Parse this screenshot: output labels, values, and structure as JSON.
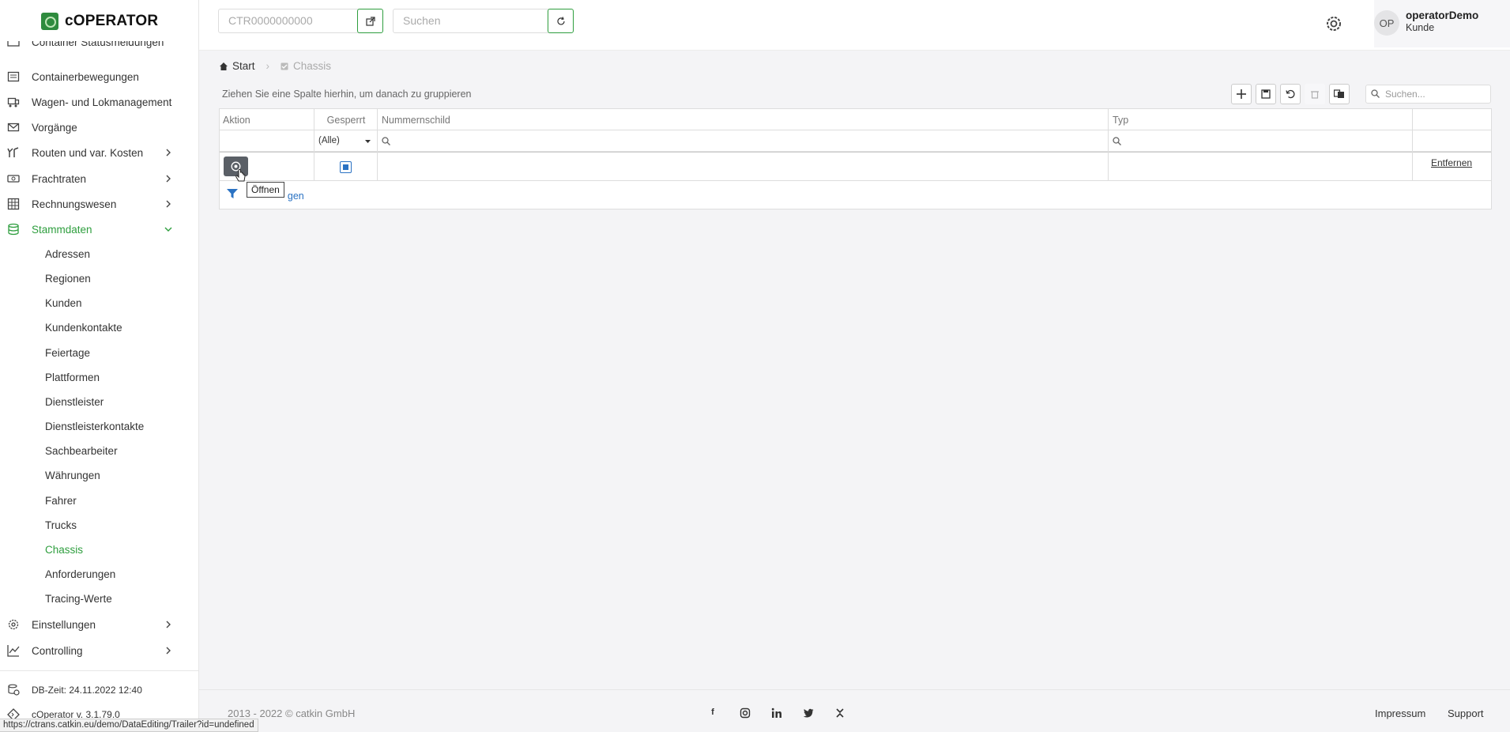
{
  "app": {
    "logo_text": "cOPERATOR"
  },
  "sidebar": {
    "cut_item": "Container Statusmeldungen",
    "items": [
      {
        "label": "Containerbewegungen",
        "icon": "calendar-icon"
      },
      {
        "label": "Wagen- und Lokmanagement",
        "icon": "wagon-icon"
      },
      {
        "label": "Vorgänge",
        "icon": "mail-icon"
      },
      {
        "label": "Routen und var. Kosten",
        "icon": "route-icon"
      },
      {
        "label": "Frachtraten",
        "icon": "money-icon"
      },
      {
        "label": "Rechnungswesen",
        "icon": "grid-icon"
      },
      {
        "label": "Stammdaten",
        "icon": "database-icon"
      }
    ],
    "subitems": [
      "Adressen",
      "Regionen",
      "Kunden",
      "Kundenkontakte",
      "Feiertage",
      "Plattformen",
      "Dienstleister",
      "Dienstleisterkontakte",
      "Sachbearbeiter",
      "Währungen",
      "Fahrer",
      "Trucks",
      "Chassis",
      "Anforderungen",
      "Tracing-Werte"
    ],
    "active_sub": "Chassis",
    "lower_items": [
      {
        "label": "Einstellungen",
        "icon": "gear-icon"
      },
      {
        "label": "Controlling",
        "icon": "chart-icon"
      }
    ],
    "db_time": "DB-Zeit: 24.11.2022 12:40",
    "version": "cOperator v. 3.1.79.0"
  },
  "topbar": {
    "container_placeholder": "CTR0000000000",
    "search_placeholder": "Suchen",
    "avatar_initials": "OP",
    "user_name": "operatorDemo",
    "user_role": "Kunde"
  },
  "breadcrumb": {
    "home": "Start",
    "current": "Chassis"
  },
  "grid": {
    "group_hint": "Ziehen Sie eine Spalte hierhin, um danach zu gruppieren",
    "search_placeholder": "Suchen...",
    "columns": [
      "Aktion",
      "Gesperrt",
      "Nummernschild",
      "Typ"
    ],
    "filter_select": "(Alle)",
    "remove_link": "Entfernen",
    "tooltip": "Öffnen",
    "filter_link": "Filter anlegen",
    "filter_link_visible": "gen"
  },
  "footer": {
    "copyright": "2013 - 2022 © catkin GmbH",
    "social": [
      "f",
      "ig",
      "in",
      "tw",
      "x"
    ],
    "links": [
      "Impressum",
      "Support"
    ]
  },
  "statusbar": {
    "url": "https://ctrans.catkin.eu/demo/DataEditing/Trailer?id=undefined"
  },
  "colors": {
    "accent": "#2e9e3e",
    "link": "#2a72c3",
    "button_dark": "#5a5f66"
  }
}
